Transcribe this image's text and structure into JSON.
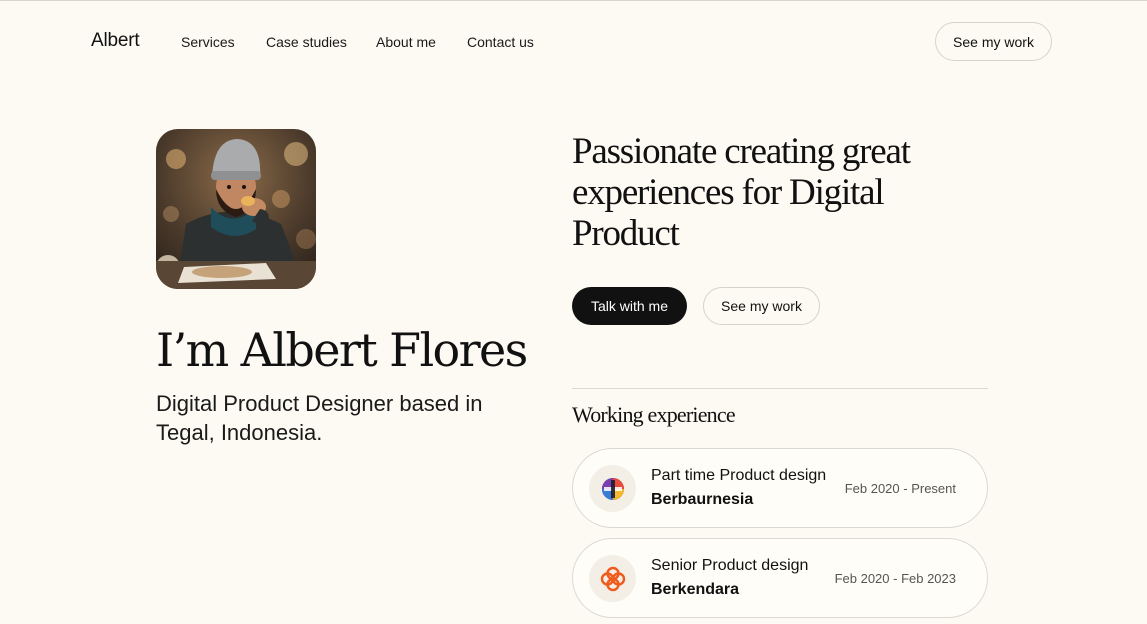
{
  "nav": {
    "logo": "Albert",
    "links": [
      "Services",
      "Case studies",
      "About me",
      "Contact us"
    ],
    "cta": "See my work"
  },
  "hero": {
    "name": "I’m Albert Flores",
    "subtitle": "Digital Product Designer based in Tegal, Indonesia.",
    "headline": "Passionate creating great experiences for Digital Product",
    "primary_button": "Talk with me",
    "secondary_button": "See my work"
  },
  "experience": {
    "title": "Working experience",
    "items": [
      {
        "role": "Part time Product design",
        "company": "Berbaurnesia",
        "dates": "Feb 2020 - Present",
        "icon": "berbaurnesia-logo-icon"
      },
      {
        "role": "Senior Product design",
        "company": "Berkendara",
        "dates": "Feb 2020 - Feb 2023",
        "icon": "berkendara-logo-icon",
        "accent": "#f05a1a"
      }
    ]
  },
  "colors": {
    "background": "#fdfaf3",
    "text": "#111111",
    "primary_button": "#111111",
    "border": "#d6d3cb"
  }
}
